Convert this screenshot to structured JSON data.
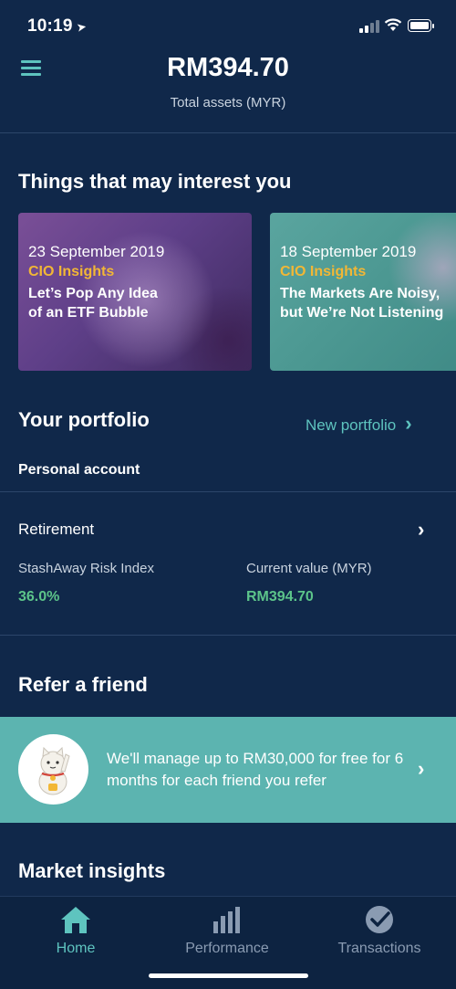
{
  "status_bar": {
    "time": "10:19"
  },
  "header": {
    "total_amount": "RM394.70",
    "total_label": "Total assets (MYR)"
  },
  "interests": {
    "title": "Things that may interest you",
    "cards": [
      {
        "date": "23 September 2019",
        "tag": "CIO Insights",
        "title": "Let’s Pop Any Idea\nof an ETF Bubble"
      },
      {
        "date": "18 September 2019",
        "tag": "CIO Insights",
        "title": "The Markets Are Noisy,\nbut We’re Not Listening"
      }
    ]
  },
  "portfolio": {
    "title": "Your portfolio",
    "new_label": "New portfolio",
    "account_label": "Personal account",
    "item_name": "Retirement",
    "risk_label": "StashAway Risk Index",
    "risk_value": "36.0%",
    "value_label": "Current value (MYR)",
    "value_amount": "RM394.70"
  },
  "refer": {
    "title": "Refer a friend",
    "text": "We'll manage up to RM30,000 for free for 6 months for each friend you refer"
  },
  "market": {
    "title": "Market insights"
  },
  "tabs": [
    {
      "label": "Home",
      "active": true
    },
    {
      "label": "Performance",
      "active": false
    },
    {
      "label": "Transactions",
      "active": false
    }
  ],
  "colors": {
    "background": "#10284a",
    "accent": "#5ec4bf",
    "positive": "#5cc48a",
    "tag": "#f2b735",
    "banner": "#5cb4b0"
  }
}
